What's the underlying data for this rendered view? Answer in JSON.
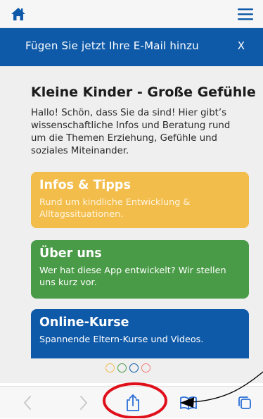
{
  "header": {
    "home_icon": "home-icon",
    "menu_icon": "hamburger-menu-icon"
  },
  "banner": {
    "text": "Fügen Sie jetzt Ihre E-Mail hinzu",
    "close_label": "X",
    "color": "#0f5aa8"
  },
  "main": {
    "title": "Kleine Kinder - Große Gefühle",
    "intro": "Hallo! Schön, dass Sie da sind! Hier gibt’s wissenschaftliche Infos und Beratung rund um die Themen Erziehung, Gefühle und soziales Miteinander.",
    "cards": [
      {
        "title": "Infos & Tipps",
        "description": "Rund um kindliche Entwicklung & Alltagssituationen.",
        "color": "#f3bd4c"
      },
      {
        "title": "Über uns",
        "description": "Wer hat diese App entwickelt? Wir stellen uns kurz vor.",
        "color": "#4a9b47"
      },
      {
        "title": "Online-Kurse",
        "description": "Spannende Eltern-Kurse und Videos.",
        "color": "#0f5aa8"
      }
    ]
  },
  "pagination": {
    "dot_colors": [
      "#f3bd4c",
      "#4a9b47",
      "#0f5aa8",
      "#f07a7a"
    ]
  },
  "toolbar": {
    "icons": [
      "back-chevron-icon",
      "forward-chevron-icon",
      "share-icon",
      "bookmarks-icon",
      "tabs-icon"
    ]
  },
  "annotation": {
    "highlight_color": "#e0101a"
  }
}
